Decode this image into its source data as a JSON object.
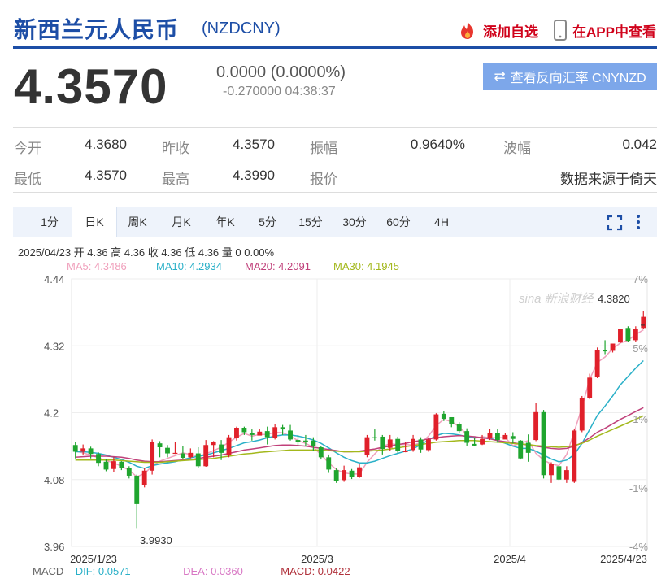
{
  "header": {
    "title": "新西兰元人民币",
    "code": "(NZDCNY)",
    "add_favorite": "添加自选",
    "app_view": "在APP中查看"
  },
  "quote": {
    "price": "4.3570",
    "change": "0.0000 (0.0000%)",
    "sub": "-0.270000 04:38:37",
    "reverse_button": "查看反向汇率 CNYNZD"
  },
  "stats": [
    {
      "label": "今开",
      "value": "4.3680"
    },
    {
      "label": "昨收",
      "value": "4.3570"
    },
    {
      "label": "振幅",
      "value": "0.9640%"
    },
    {
      "label": "波幅",
      "value": "0.042"
    },
    {
      "label": "最低",
      "value": "4.3570"
    },
    {
      "label": "最高",
      "value": "4.3990"
    },
    {
      "label": "报价",
      "value": "数据来源于倚天"
    }
  ],
  "tabs": [
    "1分",
    "日K",
    "周K",
    "月K",
    "年K",
    "5分",
    "15分",
    "30分",
    "60分",
    "4H"
  ],
  "active_tab": 1,
  "info_line": "2025/04/23 开 4.36 高 4.36 收 4.36 低 4.36 量 0 0.00%",
  "ma_legend": [
    {
      "text": "MA5: 4.3486",
      "color": "#f0a0bc"
    },
    {
      "text": "MA10: 4.2934",
      "color": "#2ab0c8"
    },
    {
      "text": "MA20: 4.2091",
      "color": "#c0407a"
    },
    {
      "text": "MA30: 4.1945",
      "color": "#a3b81c"
    }
  ],
  "macd": {
    "label": "MACD",
    "dif": "DIF: 0.0571",
    "dea": "DEA: 0.0360",
    "macd": "MACD: 0.0422"
  },
  "colors": {
    "up": "#e0202a",
    "down": "#1fa52e",
    "brand": "#1d4ea6"
  },
  "watermark": "sina 新浪财经",
  "chart_data": {
    "type": "candlestick",
    "ylim": [
      3.96,
      4.44
    ],
    "y_ticks": [
      "4.44",
      "4.32",
      "4.2",
      "4.08",
      "3.96"
    ],
    "pct_ticks": [
      "7%",
      "5%",
      "1%",
      "-1%",
      "-4%"
    ],
    "x_labels": [
      "2025/1/23",
      "2025/3",
      "2025/4",
      "2025/4/23"
    ],
    "max_label": "4.3820",
    "min_label": "3.9930",
    "candles": [
      [
        4.142,
        4.13,
        4.148,
        4.118
      ],
      [
        4.13,
        4.136,
        4.143,
        4.125
      ],
      [
        4.136,
        4.126,
        4.139,
        4.118
      ],
      [
        4.126,
        4.11,
        4.129,
        4.104
      ],
      [
        4.112,
        4.098,
        4.117,
        4.095
      ],
      [
        4.099,
        4.113,
        4.12,
        4.094
      ],
      [
        4.112,
        4.101,
        4.113,
        4.097
      ],
      [
        4.101,
        4.087,
        4.104,
        4.082
      ],
      [
        4.087,
        4.036,
        4.089,
        3.993
      ],
      [
        4.07,
        4.096,
        4.101,
        4.066
      ],
      [
        4.096,
        4.147,
        4.152,
        4.089
      ],
      [
        4.145,
        4.138,
        4.149,
        4.12
      ],
      [
        4.137,
        4.127,
        4.142,
        4.12
      ],
      [
        4.127,
        4.128,
        4.147,
        4.126
      ],
      [
        4.127,
        4.119,
        4.14,
        4.117
      ],
      [
        4.12,
        4.128,
        4.136,
        4.118
      ],
      [
        4.127,
        4.104,
        4.138,
        4.101
      ],
      [
        4.104,
        4.142,
        4.151,
        4.103
      ],
      [
        4.142,
        4.147,
        4.149,
        4.12
      ],
      [
        4.143,
        4.128,
        4.151,
        4.115
      ],
      [
        4.124,
        4.156,
        4.16,
        4.12
      ],
      [
        4.155,
        4.173,
        4.175,
        4.15
      ],
      [
        4.173,
        4.165,
        4.175,
        4.16
      ],
      [
        4.164,
        4.16,
        4.17,
        4.15
      ],
      [
        4.159,
        4.166,
        4.17,
        4.16
      ],
      [
        4.167,
        4.156,
        4.175,
        4.143
      ],
      [
        4.155,
        4.174,
        4.18,
        4.152
      ],
      [
        4.174,
        4.17,
        4.178,
        4.16
      ],
      [
        4.168,
        4.152,
        4.178,
        4.15
      ],
      [
        4.151,
        4.148,
        4.16,
        4.14
      ],
      [
        4.15,
        4.149,
        4.16,
        4.14
      ],
      [
        4.15,
        4.14,
        4.156,
        4.132
      ],
      [
        4.138,
        4.12,
        4.14,
        4.116
      ],
      [
        4.12,
        4.098,
        4.125,
        4.092
      ],
      [
        4.097,
        4.078,
        4.1,
        4.074
      ],
      [
        4.079,
        4.097,
        4.105,
        4.076
      ],
      [
        4.096,
        4.085,
        4.099,
        4.081
      ],
      [
        4.085,
        4.102,
        4.108,
        4.083
      ],
      [
        4.124,
        4.156,
        4.16,
        4.12
      ],
      [
        4.156,
        4.155,
        4.17,
        4.15
      ],
      [
        4.157,
        4.135,
        4.16,
        4.125
      ],
      [
        4.137,
        4.152,
        4.16,
        4.132
      ],
      [
        4.153,
        4.132,
        4.157,
        4.128
      ],
      [
        4.131,
        4.131,
        4.147,
        4.129
      ],
      [
        4.133,
        4.153,
        4.16,
        4.13
      ],
      [
        4.152,
        4.134,
        4.156,
        4.128
      ],
      [
        4.133,
        4.152,
        4.155,
        4.13
      ],
      [
        4.152,
        4.197,
        4.199,
        4.15
      ],
      [
        4.198,
        4.189,
        4.203,
        4.185
      ],
      [
        4.192,
        4.18,
        4.19,
        4.174
      ],
      [
        4.18,
        4.167,
        4.183,
        4.163
      ],
      [
        4.167,
        4.146,
        4.172,
        4.141
      ],
      [
        4.144,
        4.141,
        4.155,
        4.14
      ],
      [
        4.143,
        4.153,
        4.16,
        4.142
      ],
      [
        4.154,
        4.163,
        4.171,
        4.151
      ],
      [
        4.163,
        4.151,
        4.171,
        4.146
      ],
      [
        4.152,
        4.16,
        4.164,
        4.154
      ],
      [
        4.158,
        4.153,
        4.165,
        4.145
      ],
      [
        4.15,
        4.118,
        4.151,
        4.116
      ],
      [
        4.146,
        4.128,
        4.161,
        4.112
      ],
      [
        4.151,
        4.201,
        4.217,
        4.149
      ],
      [
        4.201,
        4.088,
        4.205,
        4.082
      ],
      [
        4.088,
        4.108,
        4.111,
        4.074
      ],
      [
        4.104,
        4.08,
        4.104,
        4.079
      ],
      [
        4.08,
        4.097,
        4.104,
        4.074
      ],
      [
        4.076,
        4.168,
        4.17,
        4.074
      ],
      [
        4.168,
        4.227,
        4.23,
        4.165
      ],
      [
        4.227,
        4.263,
        4.27,
        4.224
      ],
      [
        4.264,
        4.313,
        4.317,
        4.262
      ],
      [
        4.313,
        4.31,
        4.33,
        4.305
      ],
      [
        4.311,
        4.324,
        4.324,
        4.308
      ],
      [
        4.326,
        4.35,
        4.351,
        4.325
      ],
      [
        4.352,
        4.329,
        4.355,
        4.327
      ],
      [
        4.33,
        4.35,
        4.355,
        4.327
      ],
      [
        4.352,
        4.372,
        4.382,
        4.35
      ]
    ],
    "ma5": [
      4.131,
      4.128,
      4.124,
      4.119,
      4.114,
      4.11,
      4.104,
      4.097,
      4.085,
      4.091,
      4.104,
      4.113,
      4.118,
      4.123,
      4.128,
      4.125,
      4.122,
      4.126,
      4.132,
      4.138,
      4.147,
      4.156,
      4.163,
      4.158,
      4.161,
      4.161,
      4.165,
      4.164,
      4.158,
      4.15,
      4.145,
      4.138,
      4.125,
      4.11,
      4.098,
      4.092,
      4.09,
      4.09,
      4.111,
      4.126,
      4.14,
      4.144,
      4.143,
      4.143,
      4.142,
      4.146,
      4.158,
      4.177,
      4.188,
      4.184,
      4.175,
      4.16,
      4.154,
      4.157,
      4.155,
      4.155,
      4.155,
      4.141,
      4.145,
      4.15,
      4.127,
      4.115,
      4.108,
      4.105,
      4.125,
      4.166,
      4.21,
      4.26,
      4.29,
      4.3,
      4.315,
      4.325,
      4.33,
      4.34,
      4.3486
    ],
    "ma10": [
      4.13,
      4.13,
      4.129,
      4.127,
      4.124,
      4.12,
      4.116,
      4.111,
      4.104,
      4.1,
      4.105,
      4.108,
      4.11,
      4.112,
      4.116,
      4.119,
      4.122,
      4.124,
      4.128,
      4.132,
      4.136,
      4.141,
      4.146,
      4.148,
      4.151,
      4.155,
      4.158,
      4.16,
      4.16,
      4.158,
      4.155,
      4.151,
      4.145,
      4.137,
      4.128,
      4.12,
      4.114,
      4.11,
      4.11,
      4.113,
      4.118,
      4.123,
      4.127,
      4.131,
      4.135,
      4.143,
      4.151,
      4.159,
      4.163,
      4.162,
      4.16,
      4.157,
      4.156,
      4.155,
      4.154,
      4.15,
      4.145,
      4.14,
      4.136,
      4.136,
      4.131,
      4.124,
      4.117,
      4.112,
      4.115,
      4.125,
      4.145,
      4.17,
      4.195,
      4.212,
      4.23,
      4.25,
      4.265,
      4.28,
      4.2934
    ],
    "ma20": [
      4.12,
      4.121,
      4.122,
      4.122,
      4.122,
      4.121,
      4.12,
      4.118,
      4.115,
      4.113,
      4.112,
      4.112,
      4.113,
      4.114,
      4.115,
      4.116,
      4.118,
      4.12,
      4.122,
      4.124,
      4.127,
      4.13,
      4.133,
      4.135,
      4.137,
      4.139,
      4.141,
      4.142,
      4.142,
      4.141,
      4.14,
      4.138,
      4.136,
      4.134,
      4.132,
      4.13,
      4.13,
      4.131,
      4.133,
      4.135,
      4.138,
      4.14,
      4.143,
      4.145,
      4.148,
      4.15,
      4.153,
      4.155,
      4.157,
      4.158,
      4.159,
      4.158,
      4.157,
      4.155,
      4.153,
      4.15,
      4.148,
      4.146,
      4.144,
      4.142,
      4.14,
      4.138,
      4.136,
      4.135,
      4.136,
      4.14,
      4.146,
      4.155,
      4.165,
      4.172,
      4.18,
      4.188,
      4.195,
      4.202,
      4.2091
    ],
    "ma30": [
      4.115,
      4.115,
      4.115,
      4.115,
      4.115,
      4.115,
      4.114,
      4.113,
      4.112,
      4.111,
      4.111,
      4.111,
      4.112,
      4.113,
      4.114,
      4.115,
      4.116,
      4.117,
      4.118,
      4.12,
      4.122,
      4.124,
      4.126,
      4.127,
      4.129,
      4.13,
      4.131,
      4.132,
      4.133,
      4.133,
      4.133,
      4.133,
      4.133,
      4.132,
      4.131,
      4.13,
      4.13,
      4.13,
      4.131,
      4.132,
      4.133,
      4.135,
      4.137,
      4.139,
      4.141,
      4.143,
      4.145,
      4.147,
      4.148,
      4.149,
      4.15,
      4.15,
      4.15,
      4.149,
      4.148,
      4.147,
      4.146,
      4.145,
      4.144,
      4.143,
      4.141,
      4.14,
      4.139,
      4.138,
      4.139,
      4.141,
      4.145,
      4.151,
      4.158,
      4.164,
      4.17,
      4.176,
      4.182,
      4.188,
      4.1945
    ]
  }
}
